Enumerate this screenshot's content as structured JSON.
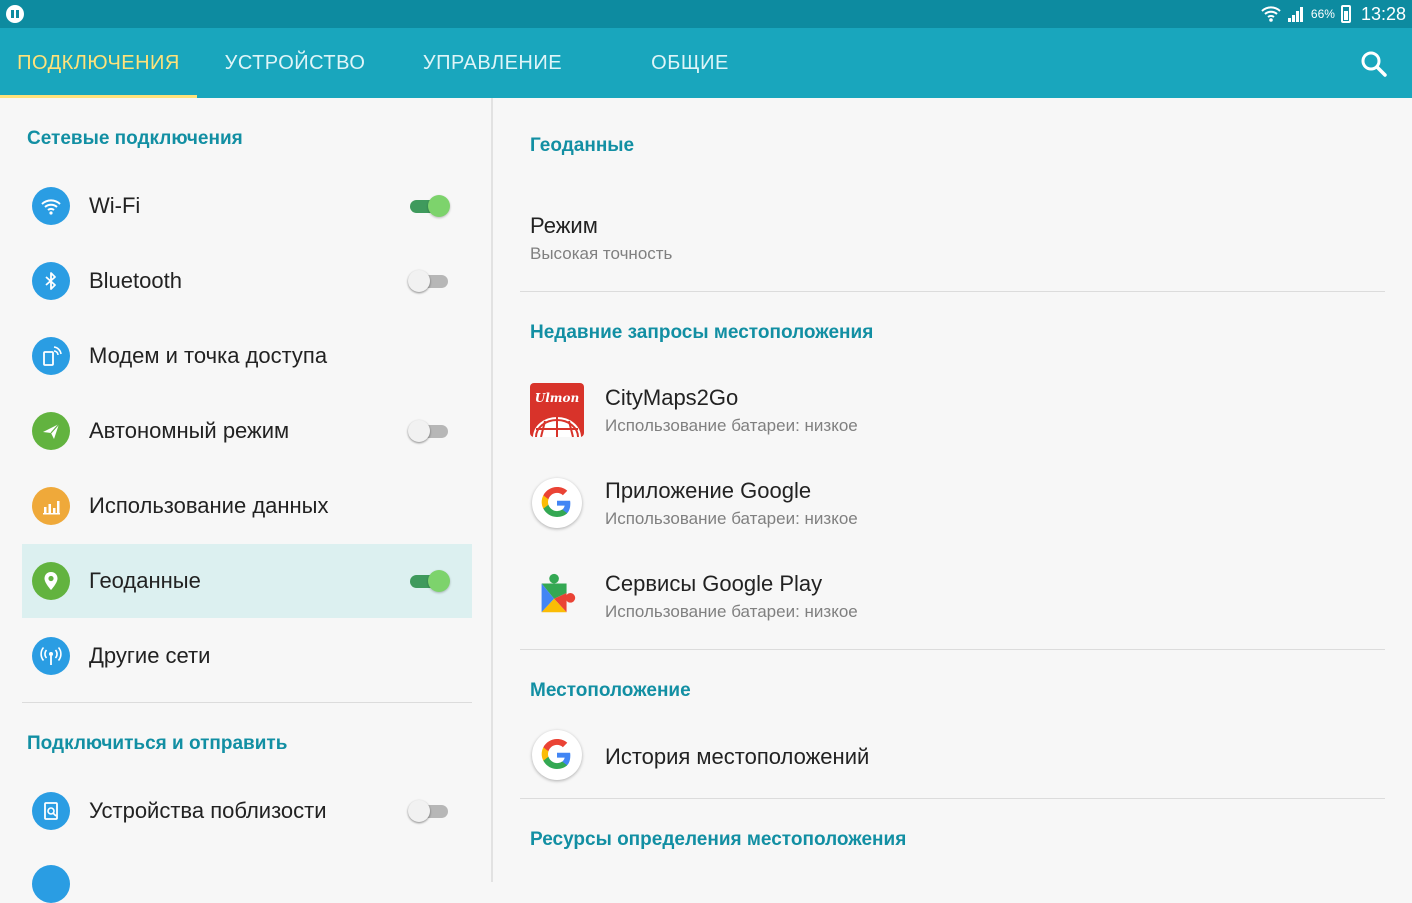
{
  "status_bar": {
    "battery": "66%",
    "time": "13:28"
  },
  "tabs": [
    {
      "label": "ПОДКЛЮЧЕНИЯ",
      "active": true
    },
    {
      "label": "УСТРОЙСТВО",
      "active": false
    },
    {
      "label": "УПРАВЛЕНИЕ",
      "active": false
    },
    {
      "label": "ОБЩИЕ",
      "active": false
    }
  ],
  "colors": {
    "tab_bar": "#19a6bd",
    "status_bar": "#0d8ba0",
    "accent_text": "#128fa3",
    "active_tab": "#ffe27a"
  },
  "sidebar": {
    "section1": "Сетевые подключения",
    "items": [
      {
        "label": "Wi-Fi",
        "icon": "wifi-icon",
        "icon_color": "#2a9de3",
        "toggle": "on"
      },
      {
        "label": "Bluetooth",
        "icon": "bluetooth-icon",
        "icon_color": "#2a9de3",
        "toggle": "off"
      },
      {
        "label": "Модем и точка доступа",
        "icon": "hotspot-icon",
        "icon_color": "#2a9de3"
      },
      {
        "label": "Автономный режим",
        "icon": "airplane-icon",
        "icon_color": "#62b33f",
        "toggle": "off"
      },
      {
        "label": "Использование данных",
        "icon": "data-usage-icon",
        "icon_color": "#efa93a"
      },
      {
        "label": "Геоданные",
        "icon": "location-icon",
        "icon_color": "#62b33f",
        "toggle": "on",
        "selected": true
      },
      {
        "label": "Другие сети",
        "icon": "other-networks-icon",
        "icon_color": "#2a9de3"
      }
    ],
    "section2": "Подключиться и отправить",
    "items2": [
      {
        "label": "Устройства поблизости",
        "icon": "nearby-devices-icon",
        "icon_color": "#2a9de3",
        "toggle": "off"
      }
    ]
  },
  "detail": {
    "title": "Геоданные",
    "mode": {
      "title": "Режим",
      "value": "Высокая точность"
    },
    "recent_header": "Недавние запросы местоположения",
    "recent": [
      {
        "name": "CityMaps2Go",
        "battery": "Использование батареи: низкое",
        "icon": "citymaps-icon",
        "logo_text": "Ulmon"
      },
      {
        "name": "Приложение Google",
        "battery": "Использование батареи: низкое",
        "icon": "google-icon"
      },
      {
        "name": "Сервисы Google Play",
        "battery": "Использование батареи: низкое",
        "icon": "google-play-services-icon"
      }
    ],
    "location_header": "Местоположение",
    "history": "История местоположений",
    "resources_header": "Ресурсы определения местоположения"
  }
}
